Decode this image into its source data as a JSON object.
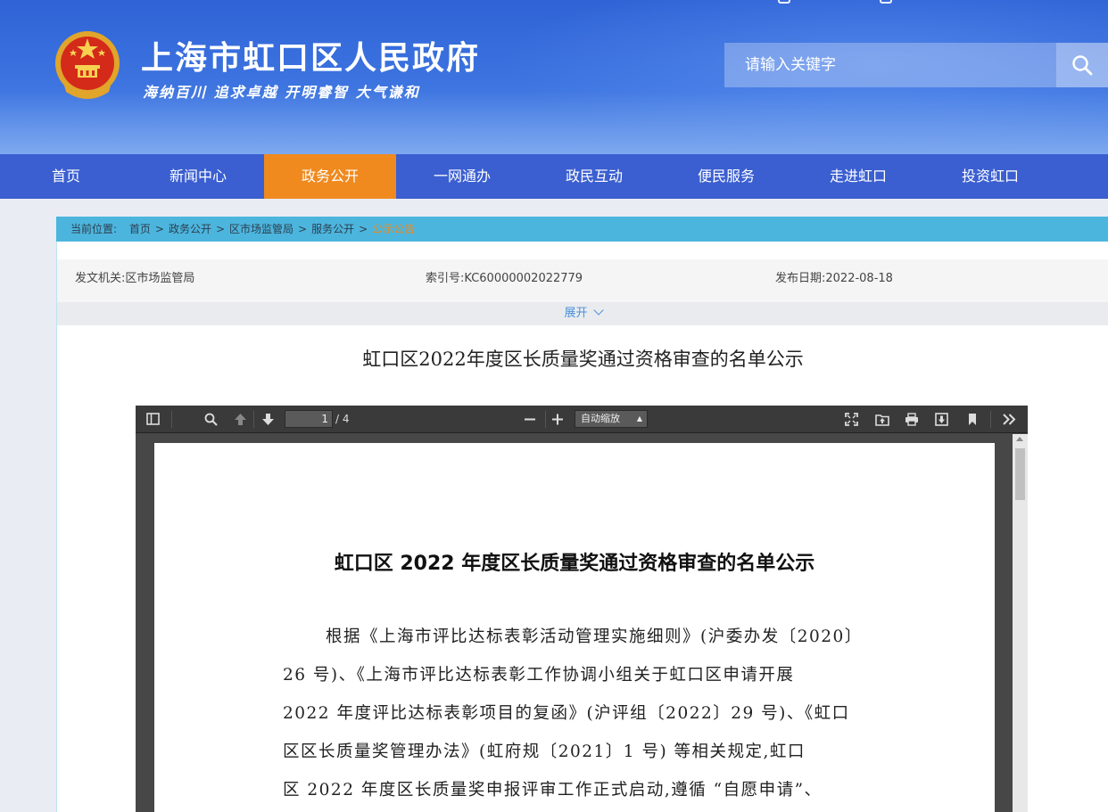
{
  "header": {
    "site_title": "上海市虹口区人民政府",
    "slogan": "海纳百川  追求卓越  开明睿智  大气谦和",
    "search_placeholder": "请输入关键字",
    "colors": {
      "header_blue": "#2f63d6",
      "nav_blue": "#3b5fd0",
      "nav_active": "#f08a1e",
      "breadcrumb_bar": "#4cb5dd"
    }
  },
  "nav": {
    "items": [
      "首页",
      "新闻中心",
      "政务公开",
      "一网通办",
      "政民互动",
      "便民服务",
      "走进虹口",
      "投资虹口"
    ],
    "active": "政务公开"
  },
  "breadcrumb": {
    "label": "当前位置:",
    "items": [
      "首页",
      "政务公开",
      "区市场监管局",
      "服务公开"
    ],
    "current": "公示公告",
    "separator": ">"
  },
  "meta": {
    "issuer": "发文机关:区市场监管局",
    "index_no": "索引号:KC60000002022779",
    "date": "发布日期:2022-08-18",
    "expand": "展开"
  },
  "document_title": "虹口区2022年度区长质量奖通过资格审查的名单公示",
  "pdf_viewer": {
    "page_number": "1",
    "page_count": "/ 4",
    "zoom": "自动缩放",
    "icons": [
      "sidebar-toggle-icon",
      "search-icon",
      "prev-page-icon",
      "next-page-icon",
      "zoom-out-icon",
      "zoom-in-icon",
      "presentation-mode-icon",
      "open-file-icon",
      "print-icon",
      "download-icon",
      "bookmark-icon",
      "tools-icon"
    ],
    "page": {
      "title": "虹口区 2022 年度区长质量奖通过资格审查的名单公示",
      "lines": [
        "根据《上海市评比达标表彰活动管理实施细则》(沪委办发〔2020〕",
        "26 号)、《上海市评比达标表彰工作协调小组关于虹口区申请开展",
        "2022 年度评比达标表彰项目的复函》(沪评组〔2022〕29 号)、《虹口",
        "区区长质量奖管理办法》(虹府规〔2021〕1 号) 等相关规定,虹口",
        "区 2022 年度区长质量奖申报评审工作正式启动,遵循 “自愿申请”、"
      ]
    }
  }
}
